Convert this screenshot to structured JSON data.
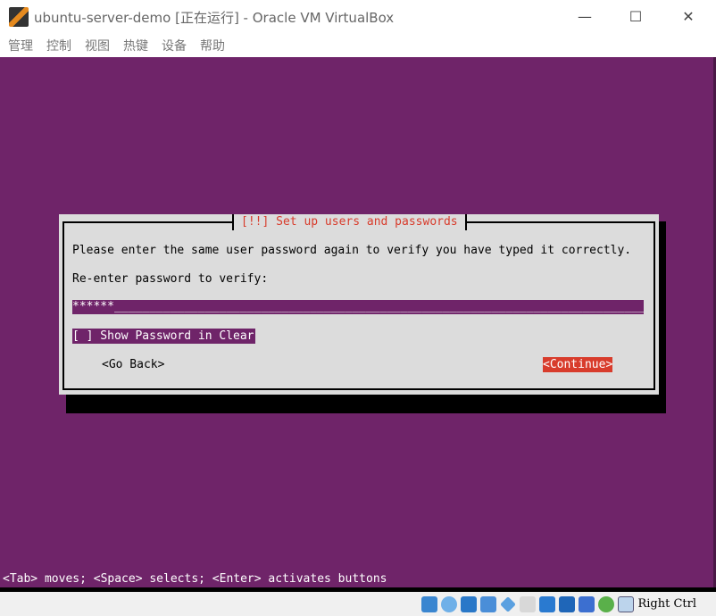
{
  "window": {
    "title": "ubuntu-server-demo [正在运行] - Oracle VM VirtualBox",
    "minimize": "—",
    "maximize": "☐",
    "close": "✕"
  },
  "menu": [
    "管理",
    "控制",
    "视图",
    "热键",
    "设备",
    "帮助"
  ],
  "dialog": {
    "title": "[!!] Set up users and passwords",
    "message": "Please enter the same user password again to verify you have typed it correctly.",
    "prompt": "Re-enter password to verify:",
    "password_value": "******",
    "password_fill": "_______________________________________________________________________________",
    "checkbox": "[ ] Show Password in Clear",
    "go_back": "<Go Back>",
    "continue": "<Continue>"
  },
  "hint": "<Tab> moves; <Space> selects; <Enter> activates buttons",
  "statusbar": {
    "icons": [
      "hard-disk-icon",
      "optical-disk-icon",
      "audio-icon",
      "network-icon",
      "usb-icon",
      "shared-folder-icon",
      "display-icon",
      "video-capture-icon",
      "cpu-icon",
      "mouse-integration-icon",
      "keyboard-capture-icon"
    ],
    "host_key": "Right Ctrl"
  },
  "colors": {
    "screen": "#6f2469",
    "accent": "#d83c2c",
    "dialog": "#dcdcdc"
  }
}
